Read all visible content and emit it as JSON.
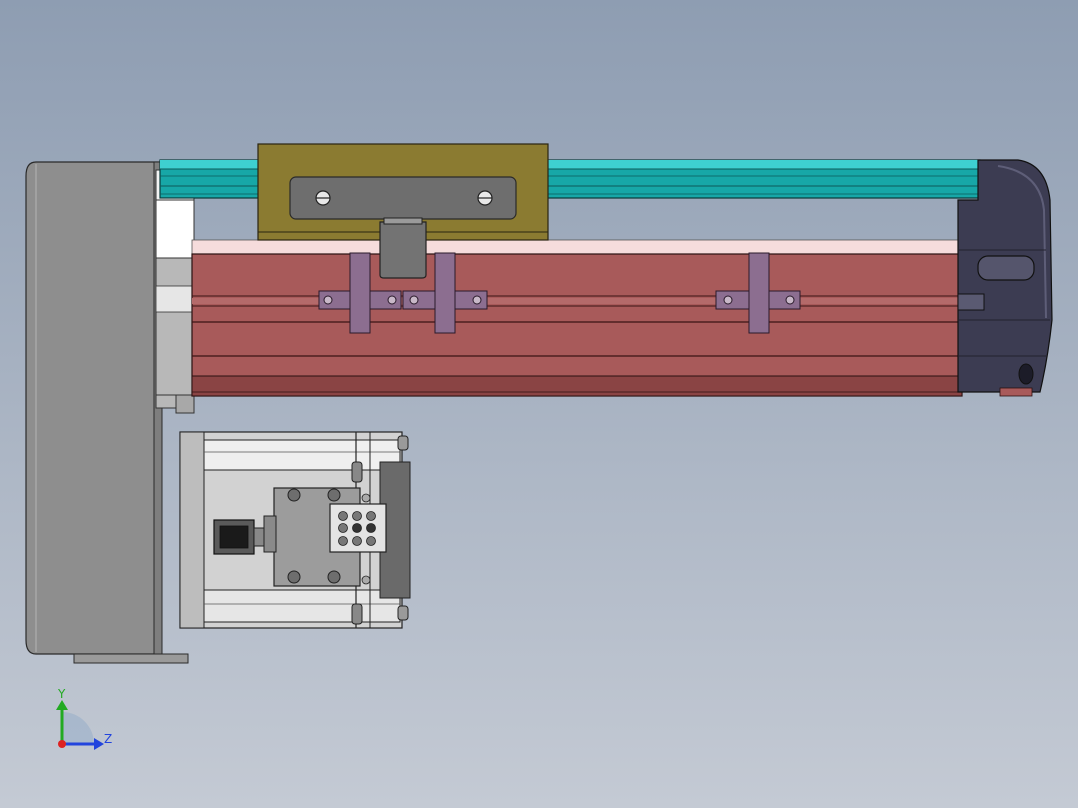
{
  "scene": {
    "type": "cad-assembly-side-view",
    "components": [
      "end-plate",
      "guide-rail",
      "carriage-block",
      "actuator-body",
      "mounting-brackets",
      "end-cap",
      "servo-motor",
      "motor-connector"
    ]
  },
  "colors": {
    "background_top": "#8e9db2",
    "background_bottom": "#c4cad4",
    "end_plate": "#8e8e8e",
    "rail": "#18a8a8",
    "carriage": "#8a7a30",
    "body": "#a65a5a",
    "bracket": "#8c6e90",
    "end_cap": "#3a3a50",
    "motor": "#cfcfcf"
  },
  "triad": {
    "y_label": "Y",
    "z_label": "Z",
    "y_color": "#22aa22",
    "z_color": "#2244dd",
    "x_color": "#dd2222"
  }
}
